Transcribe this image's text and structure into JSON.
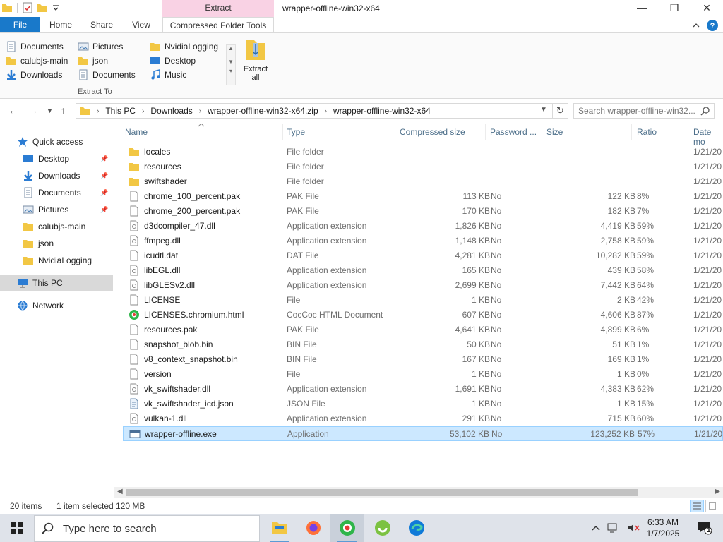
{
  "window": {
    "title": "wrapper-offline-win32-x64",
    "context_tab_group": "Extract",
    "minimize": "—",
    "maximize": "❐",
    "close": "✕"
  },
  "ribbon": {
    "tabs": [
      "File",
      "Home",
      "Share",
      "View",
      "Compressed Folder Tools"
    ],
    "active_tab": "Compressed Folder Tools",
    "locations": [
      "Documents",
      "calubjs-main",
      "Downloads",
      "Pictures",
      "json",
      "Documents",
      "NvidiaLogging",
      "Desktop",
      "Music"
    ],
    "group_label": "Extract To",
    "extract_all": [
      "Extract",
      "all"
    ]
  },
  "address": {
    "crumbs": [
      "This PC",
      "Downloads",
      "wrapper-offline-win32-x64.zip",
      "wrapper-offline-win32-x64"
    ],
    "search_placeholder": "Search wrapper-offline-win32..."
  },
  "nav": {
    "items": [
      {
        "label": "Quick access",
        "icon": "star-icon",
        "pinned": false
      },
      {
        "label": "Desktop",
        "icon": "desktop-icon",
        "pinned": true
      },
      {
        "label": "Downloads",
        "icon": "download-icon",
        "pinned": true
      },
      {
        "label": "Documents",
        "icon": "document-icon",
        "pinned": true
      },
      {
        "label": "Pictures",
        "icon": "picture-icon",
        "pinned": true
      },
      {
        "label": "calubjs-main",
        "icon": "folder-icon",
        "pinned": false
      },
      {
        "label": "json",
        "icon": "folder-icon",
        "pinned": false
      },
      {
        "label": "NvidiaLogging",
        "icon": "folder-icon",
        "pinned": false
      },
      {
        "label": "This PC",
        "icon": "computer-icon",
        "pinned": false
      },
      {
        "label": "Network",
        "icon": "network-icon",
        "pinned": false
      }
    ],
    "selected": "This PC"
  },
  "columns": [
    "Name",
    "Type",
    "Compressed size",
    "Password ...",
    "Size",
    "Ratio",
    "Date mo"
  ],
  "files": [
    {
      "name": "locales",
      "type": "File folder",
      "csize": "",
      "pw": "",
      "size": "",
      "ratio": "",
      "date": "1/21/20",
      "icon": "folder"
    },
    {
      "name": "resources",
      "type": "File folder",
      "csize": "",
      "pw": "",
      "size": "",
      "ratio": "",
      "date": "1/21/20",
      "icon": "folder"
    },
    {
      "name": "swiftshader",
      "type": "File folder",
      "csize": "",
      "pw": "",
      "size": "",
      "ratio": "",
      "date": "1/21/20",
      "icon": "folder"
    },
    {
      "name": "chrome_100_percent.pak",
      "type": "PAK File",
      "csize": "113 KB",
      "pw": "No",
      "size": "122 KB",
      "ratio": "8%",
      "date": "1/21/20",
      "icon": "file"
    },
    {
      "name": "chrome_200_percent.pak",
      "type": "PAK File",
      "csize": "170 KB",
      "pw": "No",
      "size": "182 KB",
      "ratio": "7%",
      "date": "1/21/20",
      "icon": "file"
    },
    {
      "name": "d3dcompiler_47.dll",
      "type": "Application extension",
      "csize": "1,826 KB",
      "pw": "No",
      "size": "4,419 KB",
      "ratio": "59%",
      "date": "1/21/20",
      "icon": "dll"
    },
    {
      "name": "ffmpeg.dll",
      "type": "Application extension",
      "csize": "1,148 KB",
      "pw": "No",
      "size": "2,758 KB",
      "ratio": "59%",
      "date": "1/21/20",
      "icon": "dll"
    },
    {
      "name": "icudtl.dat",
      "type": "DAT File",
      "csize": "4,281 KB",
      "pw": "No",
      "size": "10,282 KB",
      "ratio": "59%",
      "date": "1/21/20",
      "icon": "file"
    },
    {
      "name": "libEGL.dll",
      "type": "Application extension",
      "csize": "165 KB",
      "pw": "No",
      "size": "439 KB",
      "ratio": "58%",
      "date": "1/21/20",
      "icon": "dll"
    },
    {
      "name": "libGLESv2.dll",
      "type": "Application extension",
      "csize": "2,699 KB",
      "pw": "No",
      "size": "7,442 KB",
      "ratio": "64%",
      "date": "1/21/20",
      "icon": "dll"
    },
    {
      "name": "LICENSE",
      "type": "File",
      "csize": "1 KB",
      "pw": "No",
      "size": "2 KB",
      "ratio": "42%",
      "date": "1/21/20",
      "icon": "file"
    },
    {
      "name": "LICENSES.chromium.html",
      "type": "CocCoc HTML Document",
      "csize": "607 KB",
      "pw": "No",
      "size": "4,606 KB",
      "ratio": "87%",
      "date": "1/21/20",
      "icon": "html"
    },
    {
      "name": "resources.pak",
      "type": "PAK File",
      "csize": "4,641 KB",
      "pw": "No",
      "size": "4,899 KB",
      "ratio": "6%",
      "date": "1/21/20",
      "icon": "file"
    },
    {
      "name": "snapshot_blob.bin",
      "type": "BIN File",
      "csize": "50 KB",
      "pw": "No",
      "size": "51 KB",
      "ratio": "1%",
      "date": "1/21/20",
      "icon": "file"
    },
    {
      "name": "v8_context_snapshot.bin",
      "type": "BIN File",
      "csize": "167 KB",
      "pw": "No",
      "size": "169 KB",
      "ratio": "1%",
      "date": "1/21/20",
      "icon": "file"
    },
    {
      "name": "version",
      "type": "File",
      "csize": "1 KB",
      "pw": "No",
      "size": "1 KB",
      "ratio": "0%",
      "date": "1/21/20",
      "icon": "file"
    },
    {
      "name": "vk_swiftshader.dll",
      "type": "Application extension",
      "csize": "1,691 KB",
      "pw": "No",
      "size": "4,383 KB",
      "ratio": "62%",
      "date": "1/21/20",
      "icon": "dll"
    },
    {
      "name": "vk_swiftshader_icd.json",
      "type": "JSON File",
      "csize": "1 KB",
      "pw": "No",
      "size": "1 KB",
      "ratio": "15%",
      "date": "1/21/20",
      "icon": "json"
    },
    {
      "name": "vulkan-1.dll",
      "type": "Application extension",
      "csize": "291 KB",
      "pw": "No",
      "size": "715 KB",
      "ratio": "60%",
      "date": "1/21/20",
      "icon": "dll"
    },
    {
      "name": "wrapper-offline.exe",
      "type": "Application",
      "csize": "53,102 KB",
      "pw": "No",
      "size": "123,252 KB",
      "ratio": "57%",
      "date": "1/21/20",
      "icon": "exe"
    }
  ],
  "selected_file": "wrapper-offline.exe",
  "status": {
    "count": "20 items",
    "selection": "1 item selected  120 MB"
  },
  "taskbar": {
    "search_placeholder": "Type here to search",
    "time": "6:33 AM",
    "date": "1/7/2025",
    "notifications": "1"
  },
  "colors": {
    "accent": "#1979ca",
    "selection": "#cce8ff",
    "context_tab": "#f9d2e4"
  }
}
